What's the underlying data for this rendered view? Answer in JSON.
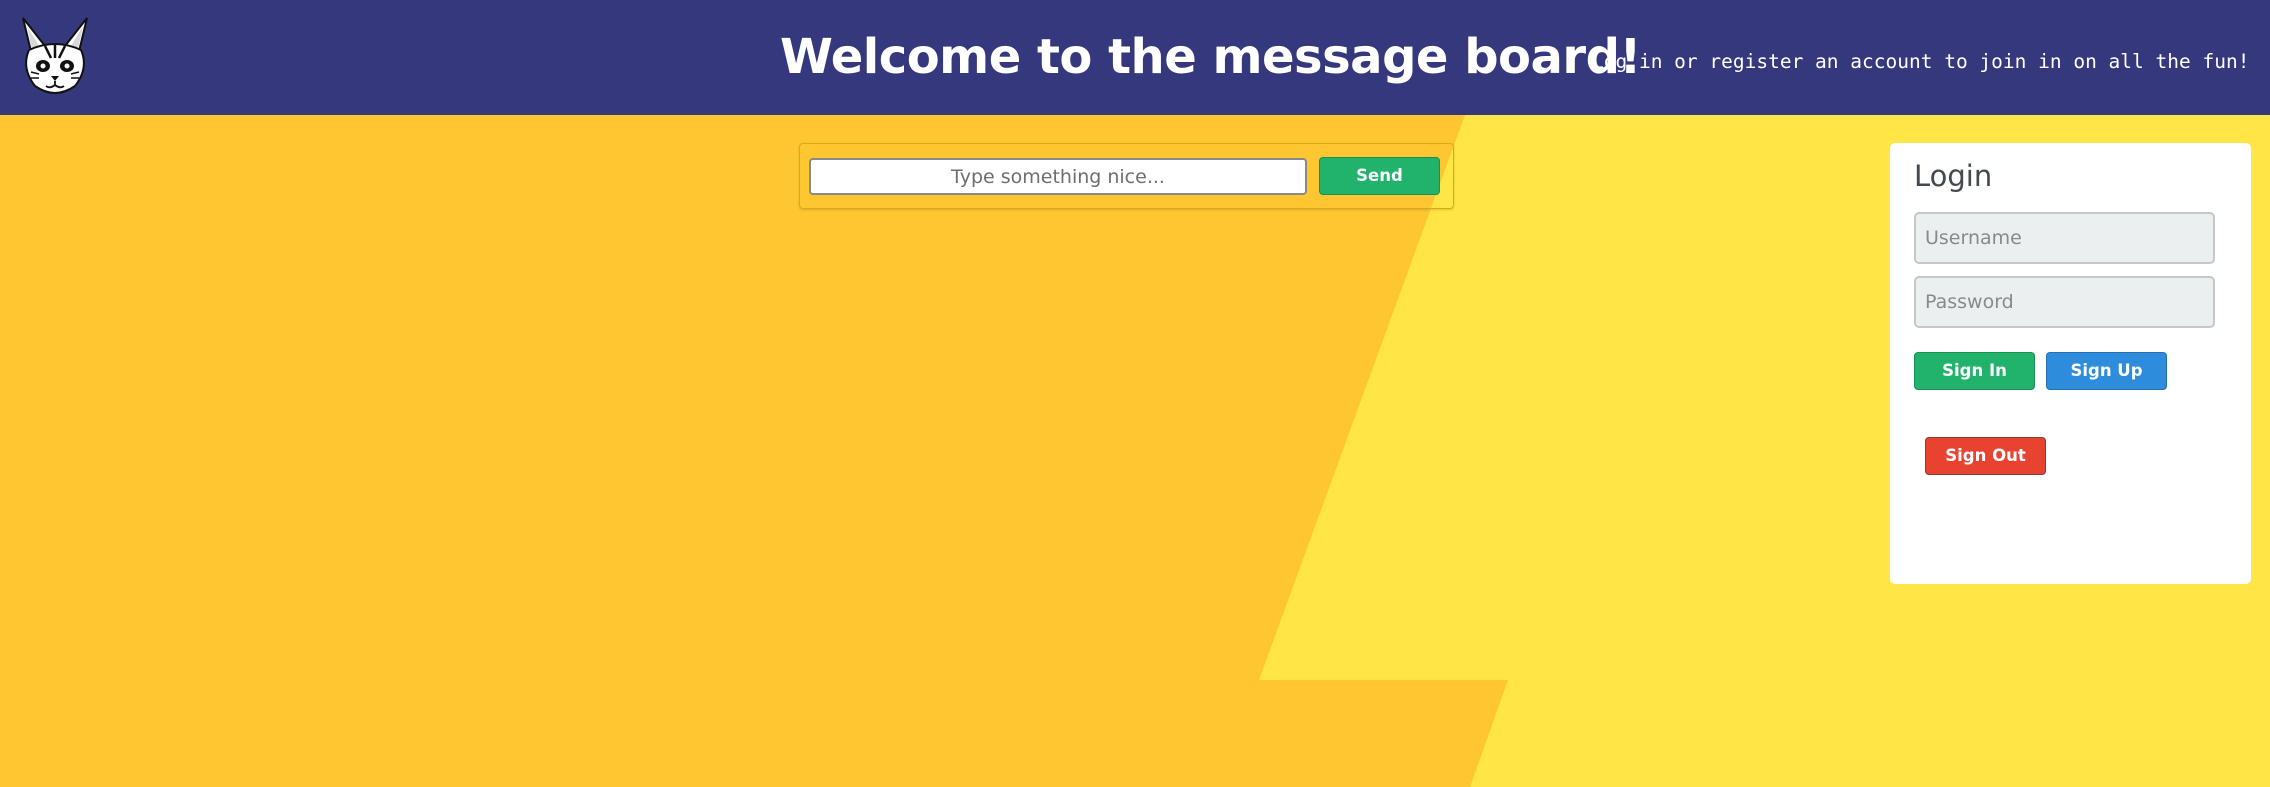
{
  "header": {
    "title": "Welcome to the message board!",
    "tagline": "Log in or register an account to join in on all the fun!",
    "logo_icon": "cat-head-logo-icon",
    "background_color": "#35387d"
  },
  "composer": {
    "placeholder": "Type something nice...",
    "value": "",
    "send_label": "Send"
  },
  "login": {
    "title": "Login",
    "username_placeholder": "Username",
    "password_placeholder": "Password",
    "signin_label": "Sign In",
    "signup_label": "Sign Up",
    "signout_label": "Sign Out"
  },
  "colors": {
    "background_main": "#fec631",
    "background_accent": "#ffe545",
    "success": "#21b36c",
    "primary": "#2d8ddc",
    "danger": "#e84331"
  }
}
